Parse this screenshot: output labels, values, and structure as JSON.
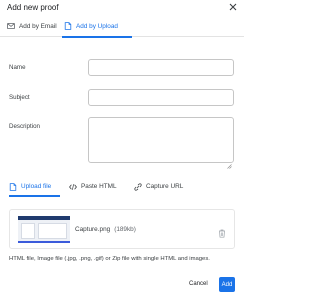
{
  "dialog": {
    "title": "Add new proof"
  },
  "tabs": [
    {
      "label": "Add by Email",
      "active": false,
      "icon": "email-icon"
    },
    {
      "label": "Add by Upload",
      "active": true,
      "icon": "upload-icon"
    }
  ],
  "form": {
    "name_label": "Name",
    "name_value": "",
    "subject_label": "Subject",
    "subject_value": "",
    "description_label": "Description",
    "description_value": ""
  },
  "source_tabs": [
    {
      "label": "Upload file",
      "active": true,
      "icon": "upload-file-icon"
    },
    {
      "label": "Paste HTML",
      "active": false,
      "icon": "code-icon"
    },
    {
      "label": "Capture URL",
      "active": false,
      "icon": "link-icon"
    }
  ],
  "file": {
    "name": "Capture.png",
    "size": "(189kb)"
  },
  "hint": "HTML file, Image file (.jpg, .png, .gif) or Zip file with single HTML and images.",
  "actions": {
    "cancel": "Cancel",
    "add": "Add"
  },
  "colors": {
    "accent": "#1a73e8",
    "border": "#c6c6c6"
  }
}
